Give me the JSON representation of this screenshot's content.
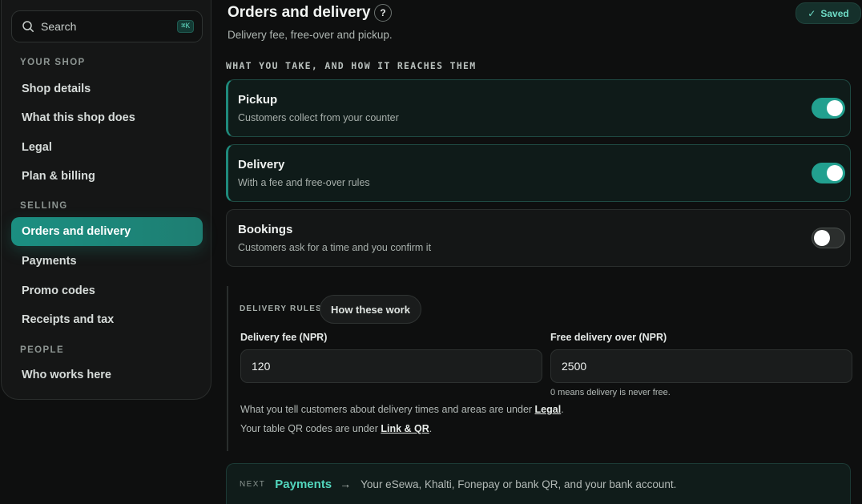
{
  "sidebar": {
    "search": {
      "placeholder": "Search",
      "shortcut": "⌘K"
    },
    "sections": [
      {
        "label": "YOUR SHOP"
      },
      {
        "label": "SELLING"
      },
      {
        "label": "PEOPLE"
      }
    ],
    "items": [
      {
        "label": "Shop details"
      },
      {
        "label": "What this shop does"
      },
      {
        "label": "Legal"
      },
      {
        "label": "Plan & billing"
      },
      {
        "label": "Orders and delivery",
        "active": true
      },
      {
        "label": "Payments"
      },
      {
        "label": "Promo codes"
      },
      {
        "label": "Receipts and tax"
      },
      {
        "label": "Who works here"
      }
    ]
  },
  "header": {
    "title": "Orders and delivery",
    "help_icon": "question-icon",
    "help_glyph": "?",
    "subtitle": "Delivery fee, free-over and pickup.",
    "status": "Saved"
  },
  "section_label": "WHAT YOU TAKE, AND HOW IT REACHES THEM",
  "options": [
    {
      "name": "Pickup",
      "description": "Customers collect from your counter",
      "enabled": true
    },
    {
      "name": "Delivery",
      "description": "With a fee and free-over rules",
      "enabled": true
    },
    {
      "name": "Bookings",
      "description": "Customers ask for a time and you confirm it",
      "enabled": false
    }
  ],
  "delivery_rules": {
    "label": "DELIVERY RULES",
    "how_button": "How these work",
    "fee_label": "Delivery fee (NPR)",
    "fee_value": "120",
    "free_over_label": "Free delivery over (NPR)",
    "free_over_value": "2500",
    "free_over_hint": "0 means delivery is never free.",
    "note1_prefix": "What you tell customers about delivery times and areas are under ",
    "note1_link": "Legal",
    "note1_suffix": ".",
    "note2_prefix": "Your table QR codes are under ",
    "note2_link": "Link & QR",
    "note2_suffix": "."
  },
  "next": {
    "keyword": "NEXT",
    "target": "Payments",
    "arrow": "→",
    "description": "Your eSewa, Khalti, Fonepay or bank QR, and your bank account."
  },
  "colors": {
    "accent": "#22a08f",
    "accent_text": "#52d6bd",
    "background": "#0e0f0f"
  }
}
